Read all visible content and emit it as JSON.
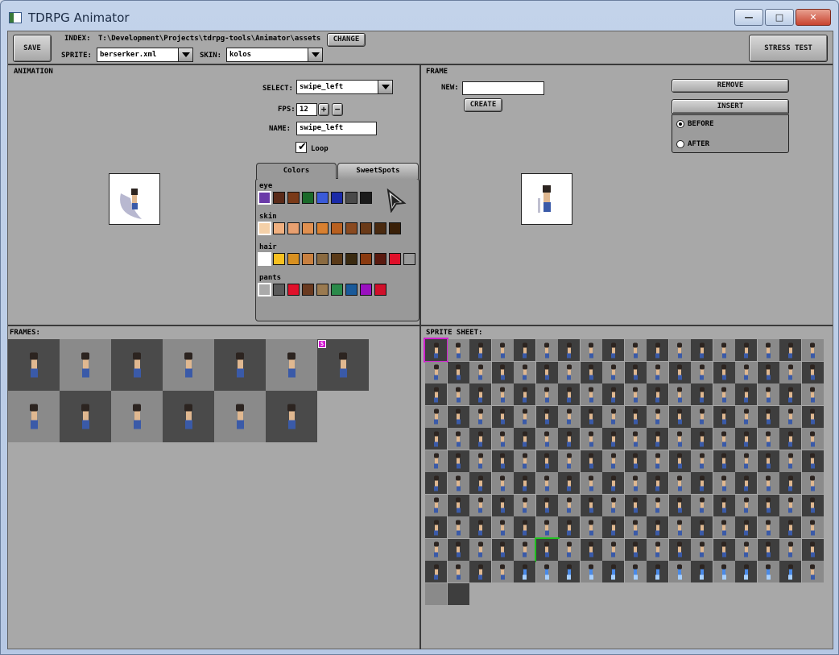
{
  "window": {
    "title": "TDRPG Animator",
    "min_glyph": "—",
    "max_glyph": "□",
    "close_glyph": "✕"
  },
  "toolbar": {
    "save_label": "SAVE",
    "index_label": "INDEX:",
    "index_path": "T:\\Development\\Projects\\tdrpg-tools\\Animator\\assets",
    "change_label": "CHANGE",
    "sprite_label": "SPRITE:",
    "sprite_value": "berserker.xml",
    "skin_label": "SKIN:",
    "skin_value": "kolos",
    "stress_label": "STRESS TEST"
  },
  "animation": {
    "header": "ANIMATION",
    "select_label": "SELECT:",
    "select_value": "swipe_left",
    "fps_label": "FPS:",
    "fps_value": "12",
    "fps_plus": "+",
    "fps_minus": "−",
    "name_label": "NAME:",
    "name_value": "swipe_left",
    "loop_label": "Loop",
    "loop_checked": true
  },
  "tabs": {
    "colors_label": "Colors",
    "sweetspots_label": "SweetSpots",
    "groups": [
      {
        "label": "eye",
        "colors": [
          "#6a3aa8",
          "#5a2a18",
          "#7a3a18",
          "#1a6a2a",
          "#3a5ad8",
          "#1a2aa8",
          "#4a4a4a",
          "#1a1a1a"
        ]
      },
      {
        "label": "skin",
        "colors": [
          "#f4d0a8",
          "#f0b080",
          "#e8a070",
          "#e09050",
          "#d88030",
          "#b86020",
          "#8a4a20",
          "#6a3a18",
          "#4a2a10",
          "#3a2008"
        ]
      },
      {
        "label": "hair",
        "colors": [
          "#ffffff",
          "#f8c020",
          "#d89020",
          "#c88040",
          "#8a6a40",
          "#5a3a18",
          "#3a2a10",
          "#8a3a10",
          "#5a1a10",
          "#e0102a",
          "#9a9a9a"
        ]
      },
      {
        "label": "pants",
        "colors": [
          "#aaaaaa",
          "#5a5a5a",
          "#e0102a",
          "#6a3a20",
          "#9a7a50",
          "#2a8a4a",
          "#1a5a9a",
          "#9a10c0",
          "#d0102a"
        ]
      }
    ]
  },
  "frame": {
    "header": "FRAME",
    "new_label": "NEW:",
    "new_value": "",
    "create_label": "CREATE",
    "remove_label": "REMOVE",
    "insert_label": "INSERT",
    "before_label": "BEFORE",
    "after_label": "AFTER",
    "insert_position": "before"
  },
  "frames_panel": {
    "header": "FRAMES:",
    "frame_count": 13,
    "sweetspot_badge": "S"
  },
  "sprite_sheet": {
    "header": "SPRITE SHEET:",
    "cell_count": 200
  }
}
